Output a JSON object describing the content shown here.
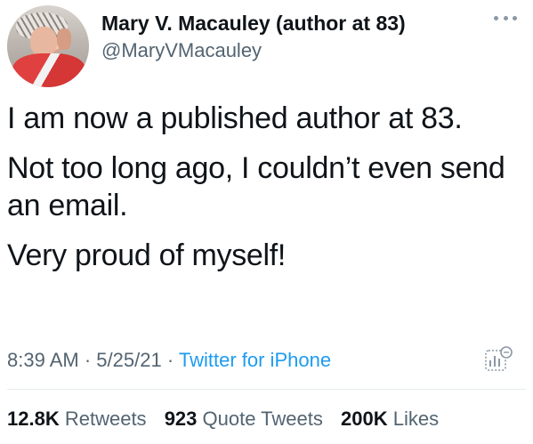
{
  "user": {
    "name": "Mary V. Macauley (author at 83)",
    "handle": "@MaryVMacauley"
  },
  "tweet": {
    "paragraphs": [
      "I am now a published author at 83.",
      "Not too long ago, I couldn’t even send an email.",
      "Very proud of myself!"
    ],
    "time": "8:39 AM",
    "date": "5/25/21",
    "separator": "·",
    "source": "Twitter for iPhone"
  },
  "stats": {
    "retweets_count": "12.8K",
    "retweets_label": "Retweets",
    "quotes_count": "923",
    "quotes_label": "Quote Tweets",
    "likes_count": "200K",
    "likes_label": "Likes"
  },
  "icons": {
    "more": "more-options-icon",
    "analytics": "tweet-analytics-icon"
  },
  "colors": {
    "text": "#0f1419",
    "secondary": "#536471",
    "link": "#1d9bf0"
  }
}
